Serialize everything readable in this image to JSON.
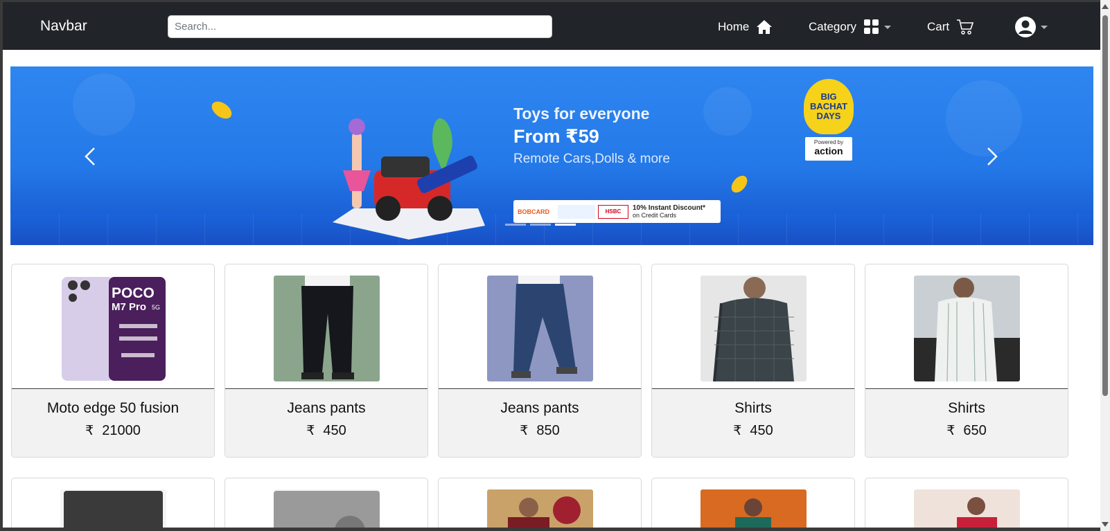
{
  "navbar": {
    "brand": "Navbar",
    "search_placeholder": "Search...",
    "home_label": "Home",
    "category_label": "Category",
    "cart_label": "Cart"
  },
  "banner": {
    "title": "Toys for everyone",
    "price_line": "From ₹59",
    "subtitle": "Remote Cars,Dolls & more",
    "logo_line1": "BIG",
    "logo_line2": "BACHAT",
    "logo_line3": "DAYS",
    "powered_by": "Powered by",
    "powered_brand": "action",
    "bank_1": "BOBCARD",
    "bank_3": "HSBC",
    "offer_main": "10% Instant Discount*",
    "offer_sub": "on Credit Cards"
  },
  "currency_symbol": "₹",
  "products": [
    {
      "name": "Moto edge 50 fusion",
      "price": "21000",
      "image": "phone"
    },
    {
      "name": "Jeans pants",
      "price": "450",
      "image": "black-jeans"
    },
    {
      "name": "Jeans pants",
      "price": "850",
      "image": "blue-jeans"
    },
    {
      "name": "Shirts",
      "price": "450",
      "image": "check-shirt"
    },
    {
      "name": "Shirts",
      "price": "650",
      "image": "white-shirt"
    }
  ],
  "phone_image_text": {
    "brand": "POCO",
    "model": "M7 Pro",
    "tag": "5G"
  },
  "colors": {
    "navbar_bg": "#212529",
    "banner_blue": "#2479e8",
    "card_footer": "#f2f2f2"
  }
}
